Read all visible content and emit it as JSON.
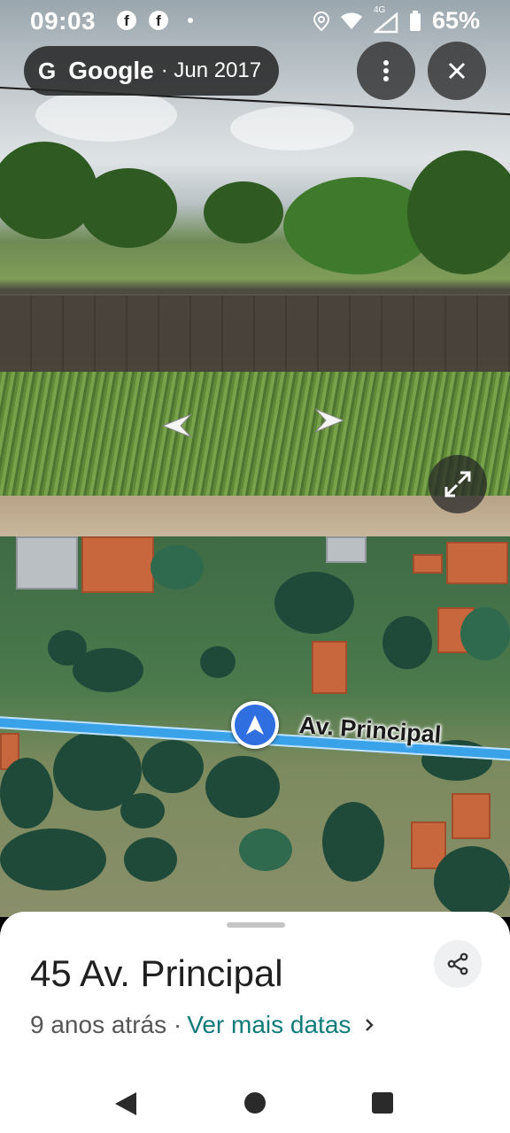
{
  "status_bar": {
    "time": "09:03",
    "notification_icons": [
      "facebook-icon",
      "facebook-icon",
      "dot-icon"
    ],
    "fb_glyph": "f",
    "network": "4G",
    "battery": "65%"
  },
  "header": {
    "brand_icon": "G",
    "brand": "Google",
    "separator_date": "· Jun 2017",
    "menu_icon": "more-vert-icon",
    "close_icon": "close-icon"
  },
  "street_view": {
    "expand_icon": "fullscreen-icon",
    "prev_icon": "arrow-left-icon",
    "next_icon": "arrow-right-icon"
  },
  "map": {
    "street_name": "Av. Principal",
    "marker_icon": "navigation-arrow-icon",
    "road_color": "#3aa2e8"
  },
  "place": {
    "title": "45 Av. Principal",
    "age": "9 anos atrás ·",
    "more_dates": "Ver mais datas",
    "share_icon": "share-icon",
    "link_color": "#0f7a7a"
  },
  "nav": {
    "back": "back-icon",
    "home": "home-icon",
    "recents": "recents-icon"
  }
}
